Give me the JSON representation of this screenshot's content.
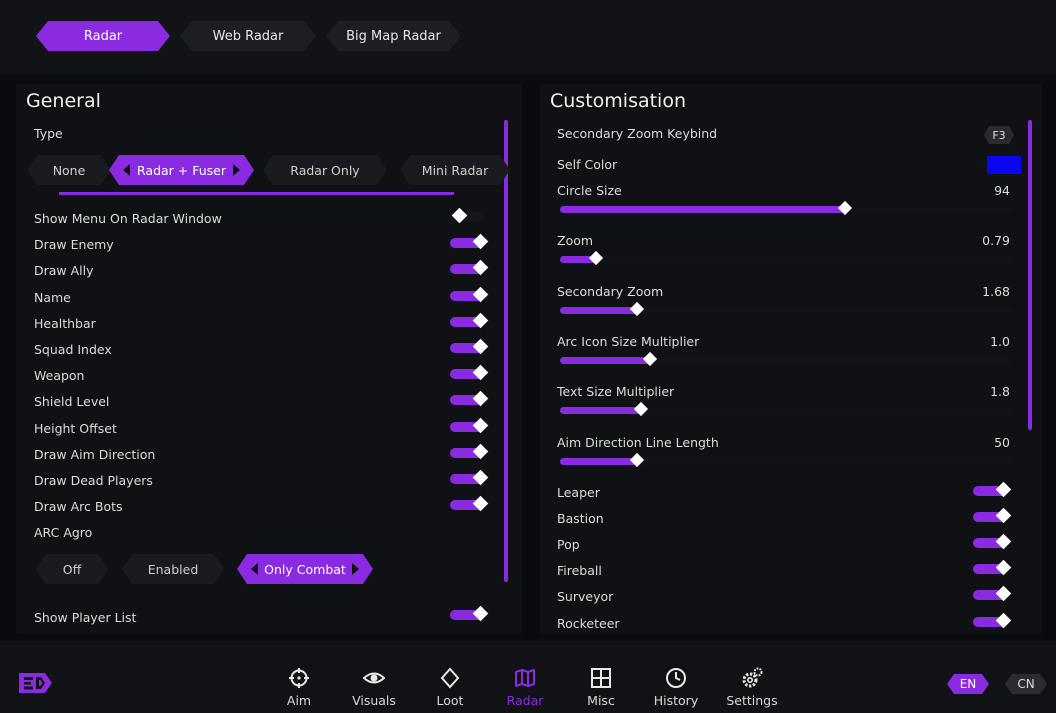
{
  "top_tabs": [
    "Radar",
    "Web Radar",
    "Big Map Radar"
  ],
  "general": {
    "title": "General",
    "type_label": "Type",
    "type_options": [
      "None",
      "Radar + Fuser",
      "Radar Only",
      "Mini Radar"
    ],
    "type_selected": "Radar + Fuser",
    "toggles": [
      {
        "label": "Show Menu On Radar Window",
        "on": false
      },
      {
        "label": "Draw Enemy",
        "on": true
      },
      {
        "label": "Draw Ally",
        "on": true
      },
      {
        "label": "Name",
        "on": true
      },
      {
        "label": "Healthbar",
        "on": true
      },
      {
        "label": "Squad Index",
        "on": true
      },
      {
        "label": "Weapon",
        "on": true
      },
      {
        "label": "Shield Level",
        "on": true
      },
      {
        "label": "Height Offset",
        "on": true
      },
      {
        "label": "Draw Aim Direction",
        "on": true
      },
      {
        "label": "Draw Dead Players",
        "on": true
      },
      {
        "label": "Draw Arc Bots",
        "on": true
      }
    ],
    "arc_agro_label": "ARC Agro",
    "arc_agro_options": [
      "Off",
      "Enabled",
      "Only Combat"
    ],
    "arc_agro_selected": "Only Combat",
    "show_player_list": {
      "label": "Show Player List",
      "on": true
    }
  },
  "customisation": {
    "title": "Customisation",
    "secondary_zoom_keybind": {
      "label": "Secondary Zoom Keybind",
      "key": "F3"
    },
    "self_color": {
      "label": "Self Color",
      "color": "#0a06f0"
    },
    "sliders": [
      {
        "label": "Circle Size",
        "value": "94",
        "fraction": 0.63
      },
      {
        "label": "Zoom",
        "value": "0.79",
        "fraction": 0.08
      },
      {
        "label": "Secondary Zoom",
        "value": "1.68",
        "fraction": 0.17
      },
      {
        "label": "Arc Icon Size Multiplier",
        "value": "1.0",
        "fraction": 0.2
      },
      {
        "label": "Text Size Multiplier",
        "value": "1.8",
        "fraction": 0.18
      },
      {
        "label": "Aim Direction Line Length",
        "value": "50",
        "fraction": 0.17
      }
    ],
    "toggles": [
      {
        "label": "Leaper",
        "on": true
      },
      {
        "label": "Bastion",
        "on": true
      },
      {
        "label": "Pop",
        "on": true
      },
      {
        "label": "Fireball",
        "on": true
      },
      {
        "label": "Surveyor",
        "on": true
      },
      {
        "label": "Rocketeer",
        "on": true
      }
    ]
  },
  "bottom_nav": [
    {
      "label": "Aim",
      "icon": "crosshair-icon"
    },
    {
      "label": "Visuals",
      "icon": "eye-icon"
    },
    {
      "label": "Loot",
      "icon": "diamond-icon"
    },
    {
      "label": "Radar",
      "icon": "map-icon"
    },
    {
      "label": "Misc",
      "icon": "grid-icon"
    },
    {
      "label": "History",
      "icon": "clock-icon"
    },
    {
      "label": "Settings",
      "icon": "gears-icon"
    }
  ],
  "bottom_nav_active": "Radar",
  "languages": [
    "EN",
    "CN"
  ],
  "language_active": "EN",
  "colors": {
    "accent": "#8a2be2",
    "background": "#0a0b0e",
    "panel": "#101115"
  }
}
